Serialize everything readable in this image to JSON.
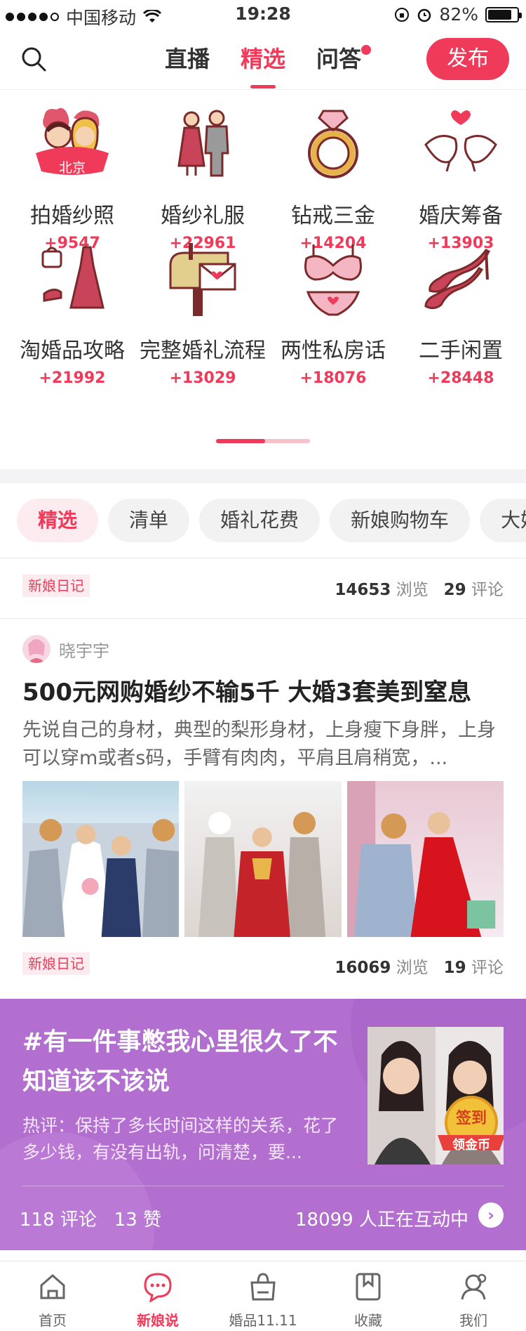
{
  "status_bar": {
    "carrier": "中国移动",
    "time": "19:28",
    "battery": "82%"
  },
  "top_nav": {
    "tabs": [
      {
        "label": "直播"
      },
      {
        "label": "精选"
      },
      {
        "label": "问答"
      }
    ],
    "publish_label": "发布"
  },
  "categories": [
    {
      "name": "拍婚纱照",
      "count": "+9547",
      "badge": "北京",
      "icon": "couple-icon"
    },
    {
      "name": "婚纱礼服",
      "count": "+22961",
      "icon": "bride-groom-icon"
    },
    {
      "name": "钻戒三金",
      "count": "+14204",
      "icon": "ring-icon"
    },
    {
      "name": "婚庆筹备",
      "count": "+13903",
      "icon": "doves-icon"
    },
    {
      "name": "淘婚品攻略",
      "count": "+21992",
      "icon": "dress-bag-icon"
    },
    {
      "name": "完整婚礼流程",
      "count": "+13029",
      "icon": "mailbox-icon"
    },
    {
      "name": "两性私房话",
      "count": "+18076",
      "icon": "lingerie-icon"
    },
    {
      "name": "二手闲置",
      "count": "+28448",
      "icon": "heels-icon"
    }
  ],
  "filter_chips": [
    "精选",
    "清单",
    "婚礼花费",
    "新娘购物车",
    "大婚"
  ],
  "post_meta_1": {
    "tag": "新娘日记",
    "views": "14653",
    "views_label": "浏览",
    "comments": "29",
    "comments_label": "评论"
  },
  "post": {
    "author": "晓宇宇",
    "title": "500元网购婚纱不输5千 大婚3套美到窒息",
    "excerpt": "先说自己的身材，典型的梨形身材，上身瘦下身胖，上身可以穿m或者s码，手臂有肉肉，平肩且肩稍宽，..."
  },
  "post_meta_2": {
    "tag": "新娘日记",
    "views": "16069",
    "views_label": "浏览",
    "comments": "19",
    "comments_label": "评论"
  },
  "promo": {
    "title": "#有一件事憋我心里很久了不知道该不该说",
    "hot_comment": "热评：保持了多长时间这样的关系，花了多少钱，有没有出轨，问清楚，要...",
    "badge_top": "签到",
    "badge_bottom": "领金币",
    "comments": "118 评论",
    "likes": "13 赞",
    "interacting": "18099 人正在互动中"
  },
  "tab_bar": [
    {
      "label": "首页",
      "icon": "home-icon"
    },
    {
      "label": "新娘说",
      "icon": "chat-icon"
    },
    {
      "label": "婚品11.11",
      "icon": "shopping-bag-icon"
    },
    {
      "label": "收藏",
      "icon": "bookmark-icon"
    },
    {
      "label": "我们",
      "icon": "profile-icon"
    }
  ],
  "colors": {
    "accent": "#f03a5a",
    "promo_bg": "#b36fd0",
    "icon_maroon": "#8b2c3a"
  }
}
